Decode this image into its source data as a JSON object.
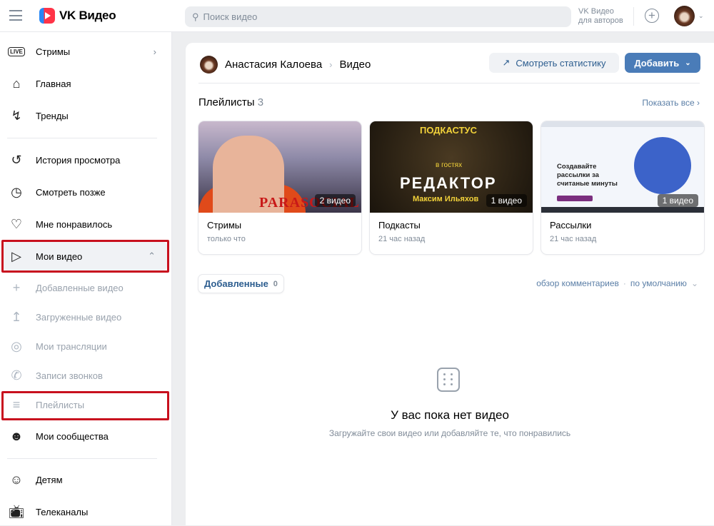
{
  "header": {
    "logo": "VK Видео",
    "search_placeholder": "Поиск видео",
    "creators_line1": "VK Видео",
    "creators_line2": "для авторов"
  },
  "sidebar": {
    "items": [
      {
        "label": "Стримы",
        "icon": "live-icon"
      },
      {
        "label": "Главная",
        "icon": "home-icon"
      },
      {
        "label": "Тренды",
        "icon": "lightning-icon"
      },
      {
        "label": "История просмотра",
        "icon": "history-icon"
      },
      {
        "label": "Смотреть позже",
        "icon": "clock-icon"
      },
      {
        "label": "Мне понравилось",
        "icon": "heart-icon"
      },
      {
        "label": "Мои видео",
        "icon": "video-icon"
      },
      {
        "label": "Добавленные видео",
        "icon": "plus-icon"
      },
      {
        "label": "Загруженные видео",
        "icon": "upload-icon"
      },
      {
        "label": "Мои трансляции",
        "icon": "broadcast-icon"
      },
      {
        "label": "Записи звонков",
        "icon": "phone-icon"
      },
      {
        "label": "Плейлисты",
        "icon": "playlist-icon"
      },
      {
        "label": "Мои сообщества",
        "icon": "users-icon"
      },
      {
        "label": "Детям",
        "icon": "kids-icon"
      },
      {
        "label": "Телеканалы",
        "icon": "tv-icon"
      }
    ],
    "live_badge": "LIVE"
  },
  "main": {
    "breadcrumb": {
      "user": "Анастасия Калоева",
      "page": "Видео"
    },
    "stats_button": "Смотреть статистику",
    "add_button": "Добавить",
    "playlists_title": "Плейлисты",
    "playlists_count": "3",
    "show_all": "Показать все",
    "playlists": [
      {
        "name": "Стримы",
        "time": "только что",
        "count": "2 видео",
        "thumb_text": "PARASOCIAL"
      },
      {
        "name": "Подкасты",
        "time": "21 час назад",
        "count": "1 видео",
        "thumb_text": [
          "ПОДКАСТУС",
          "в гостях",
          "РЕДАКТОР",
          "Максим Ильяхов"
        ]
      },
      {
        "name": "Рассылки",
        "time": "21 час назад",
        "count": "1 видео",
        "thumb_text": "Создавайте рассылки за считаные минуты"
      }
    ],
    "tab": {
      "label": "Добавленные",
      "count": "0"
    },
    "sort": {
      "comments": "обзор комментариев",
      "order": "по умолчанию"
    },
    "empty": {
      "title": "У вас пока нет видео",
      "subtitle": "Загружайте свои видео или добавляйте те, что понравились"
    }
  }
}
